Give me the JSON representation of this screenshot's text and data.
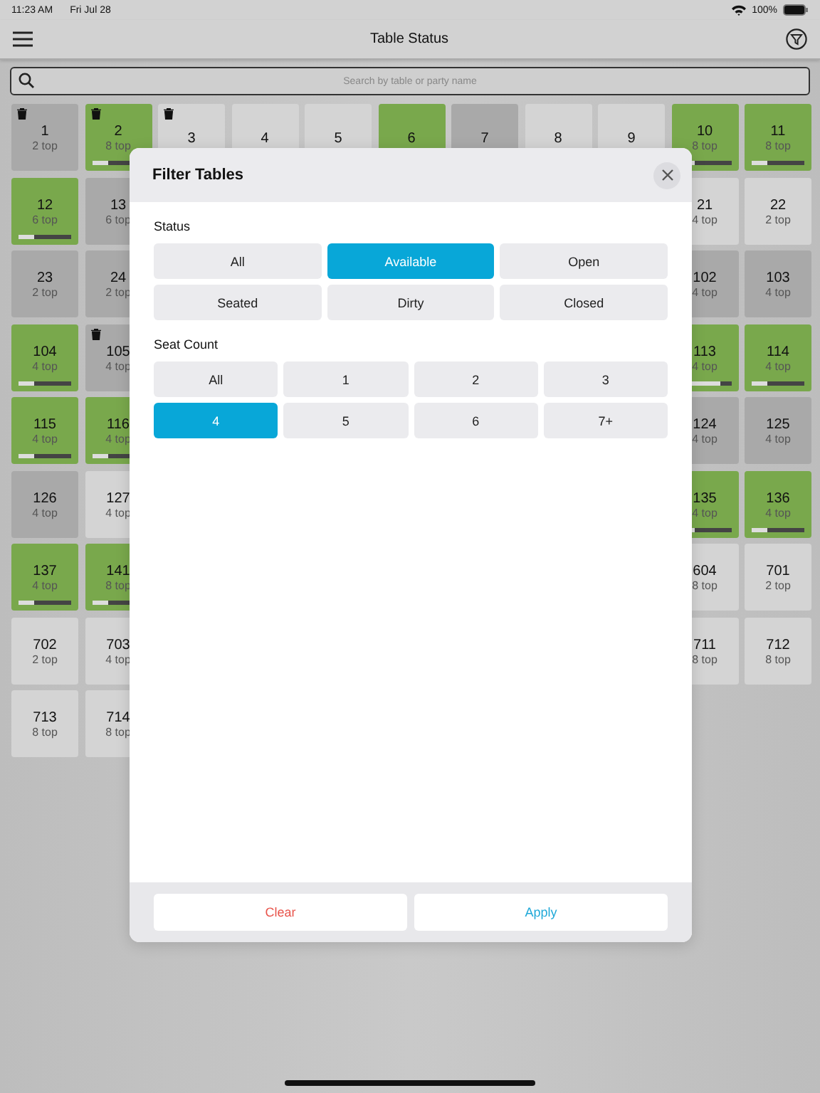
{
  "status_bar": {
    "time": "11:23 AM",
    "date": "Fri Jul 28",
    "battery": "100%"
  },
  "nav": {
    "title": "Table Status"
  },
  "search": {
    "placeholder": "Search by table or party name"
  },
  "rows": [
    {
      "left": [
        {
          "number": "1",
          "seats": "2 top",
          "color": "#a9a9a9",
          "trash": true
        },
        {
          "number": "2",
          "seats": "8 top",
          "color": "#79a84c",
          "trash": true,
          "level": 0.3
        },
        {
          "number": "3",
          "color": "#d4d4d4",
          "trash": true
        },
        {
          "number": "4",
          "color": "#d4d4d4",
          "trash": false
        },
        {
          "number": "5",
          "color": "#d4d4d4",
          "trash": false
        },
        {
          "number": "6",
          "color": "#79a84c",
          "trash": false
        },
        {
          "number": "7",
          "color": "#a9a9a9",
          "trash": false
        },
        {
          "number": "8",
          "color": "#d4d4d4",
          "trash": false
        },
        {
          "number": "9",
          "color": "#d4d4d4",
          "trash": false
        },
        {
          "number": "10",
          "seats": "8 top",
          "color": "#79a84c",
          "trash": false,
          "level": 0.3
        },
        {
          "number": "11",
          "seats": "8 top",
          "color": "#79a84c",
          "trash": false,
          "level": 0.3
        }
      ],
      "right": []
    },
    {
      "left": [
        {
          "number": "12",
          "seats": "6 top",
          "color": "#79a84c",
          "trash": false,
          "level": 0.3
        },
        {
          "number": "13",
          "seats": "6 top",
          "color": "#a9a9a9",
          "trash": false
        }
      ],
      "right": [
        {
          "number": "21",
          "seats": "4 top",
          "color": "#d4d4d4",
          "trash": false
        },
        {
          "number": "22",
          "seats": "2 top",
          "color": "#d4d4d4",
          "trash": false
        }
      ]
    },
    {
      "left": [
        {
          "number": "23",
          "seats": "2 top",
          "color": "#a9a9a9",
          "trash": false
        },
        {
          "number": "24",
          "seats": "2 top",
          "color": "#a9a9a9",
          "trash": false
        }
      ],
      "right": [
        {
          "number": "102",
          "seats": "4 top",
          "color": "#a9a9a9",
          "trash": false
        },
        {
          "number": "103",
          "seats": "4 top",
          "color": "#a9a9a9",
          "trash": false
        }
      ]
    },
    {
      "left": [
        {
          "number": "104",
          "seats": "4 top",
          "color": "#79a84c",
          "trash": false,
          "level": 0.3
        },
        {
          "number": "105",
          "seats": "4 top",
          "color": "#a9a9a9",
          "trash": true
        }
      ],
      "right": [
        {
          "number": "113",
          "seats": "4 top",
          "color": "#79a84c",
          "trash": false,
          "level": 0.8
        },
        {
          "number": "114",
          "seats": "4 top",
          "color": "#79a84c",
          "trash": false,
          "level": 0.3
        }
      ]
    },
    {
      "left": [
        {
          "number": "115",
          "seats": "4 top",
          "color": "#79a84c",
          "trash": false,
          "level": 0.3
        },
        {
          "number": "116",
          "seats": "4 top",
          "color": "#79a84c",
          "trash": false,
          "level": 0.3
        }
      ],
      "right": [
        {
          "number": "124",
          "seats": "4 top",
          "color": "#a9a9a9",
          "trash": false
        },
        {
          "number": "125",
          "seats": "4 top",
          "color": "#a9a9a9",
          "trash": false
        }
      ]
    },
    {
      "left": [
        {
          "number": "126",
          "seats": "4 top",
          "color": "#a9a9a9",
          "trash": false
        },
        {
          "number": "127",
          "seats": "4 top",
          "color": "#d4d4d4",
          "trash": false
        }
      ],
      "right": [
        {
          "number": "135",
          "seats": "4 top",
          "color": "#79a84c",
          "trash": false,
          "level": 0.3
        },
        {
          "number": "136",
          "seats": "4 top",
          "color": "#79a84c",
          "trash": false,
          "level": 0.3
        }
      ]
    },
    {
      "left": [
        {
          "number": "137",
          "seats": "4 top",
          "color": "#79a84c",
          "trash": false,
          "level": 0.3
        },
        {
          "number": "141",
          "seats": "8 top",
          "color": "#79a84c",
          "trash": false,
          "level": 0.3
        }
      ],
      "right": [
        {
          "number": "604",
          "seats": "8 top",
          "color": "#d4d4d4",
          "trash": false
        },
        {
          "number": "701",
          "seats": "2 top",
          "color": "#d4d4d4",
          "trash": false
        }
      ]
    },
    {
      "left": [
        {
          "number": "702",
          "seats": "2 top",
          "color": "#d4d4d4",
          "trash": false
        },
        {
          "number": "703",
          "seats": "4 top",
          "color": "#d4d4d4",
          "trash": false
        }
      ],
      "right": [
        {
          "number": "711",
          "seats": "8 top",
          "color": "#d4d4d4",
          "trash": false
        },
        {
          "number": "712",
          "seats": "8 top",
          "color": "#d4d4d4",
          "trash": false
        }
      ]
    },
    {
      "left": [
        {
          "number": "713",
          "seats": "8 top",
          "color": "#d4d4d4",
          "trash": false
        },
        {
          "number": "714",
          "seats": "8 top",
          "color": "#d4d4d4",
          "trash": false
        }
      ],
      "right": []
    }
  ],
  "modal": {
    "title": "Filter Tables",
    "status_label": "Status",
    "status_options": [
      {
        "label": "All",
        "selected": false
      },
      {
        "label": "Available",
        "selected": true
      },
      {
        "label": "Open",
        "selected": false
      },
      {
        "label": "Seated",
        "selected": false
      },
      {
        "label": "Dirty",
        "selected": false
      },
      {
        "label": "Closed",
        "selected": false
      }
    ],
    "seat_label": "Seat Count",
    "seat_options": [
      {
        "label": "All",
        "selected": false
      },
      {
        "label": "1",
        "selected": false
      },
      {
        "label": "2",
        "selected": false
      },
      {
        "label": "3",
        "selected": false
      },
      {
        "label": "4",
        "selected": true
      },
      {
        "label": "5",
        "selected": false
      },
      {
        "label": "6",
        "selected": false
      },
      {
        "label": "7+",
        "selected": false
      }
    ],
    "buttons": [
      {
        "label": "Clear",
        "kind": "destructive"
      },
      {
        "label": "Apply",
        "kind": "primary"
      }
    ]
  }
}
